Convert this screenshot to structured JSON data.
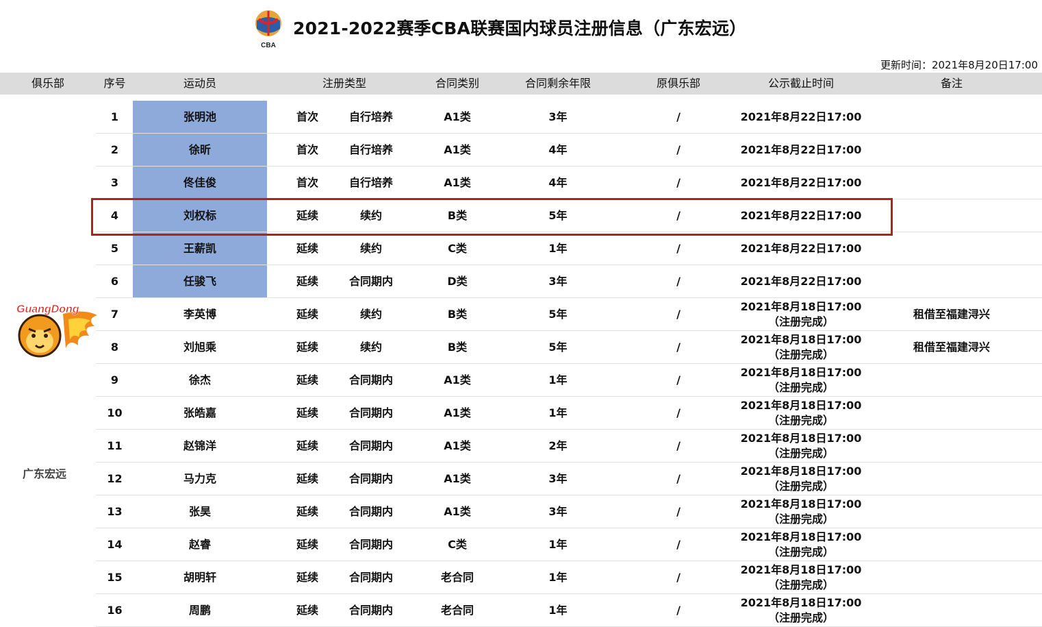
{
  "header": {
    "logo_text": "CBA",
    "title": "2021-2022赛季CBA联赛国内球员注册信息（广东宏远）",
    "update_time": "更新时间：2021年8月20日17:00"
  },
  "columns": [
    "俱乐部",
    "序号",
    "运动员",
    "注册类型",
    "合同类别",
    "合同剩余年限",
    "原俱乐部",
    "公示截止时间",
    "备注"
  ],
  "club": {
    "name": "广东宏远",
    "logo_text": "GuangDong"
  },
  "highlight_color": "#b0231d",
  "name_highlight_color": "#8eaadb",
  "rows": [
    {
      "no": "1",
      "name": "张明池",
      "reg1": "首次",
      "reg2": "自行培养",
      "contract": "A1类",
      "years": "3年",
      "orig": "/",
      "deadline": "2021年8月22日17:00",
      "status": "",
      "note": ""
    },
    {
      "no": "2",
      "name": "徐昕",
      "reg1": "首次",
      "reg2": "自行培养",
      "contract": "A1类",
      "years": "4年",
      "orig": "/",
      "deadline": "2021年8月22日17:00",
      "status": "",
      "note": ""
    },
    {
      "no": "3",
      "name": "佟佳俊",
      "reg1": "首次",
      "reg2": "自行培养",
      "contract": "A1类",
      "years": "4年",
      "orig": "/",
      "deadline": "2021年8月22日17:00",
      "status": "",
      "note": ""
    },
    {
      "no": "4",
      "name": "刘权标",
      "reg1": "延续",
      "reg2": "续约",
      "contract": "B类",
      "years": "5年",
      "orig": "/",
      "deadline": "2021年8月22日17:00",
      "status": "",
      "note": ""
    },
    {
      "no": "5",
      "name": "王薪凯",
      "reg1": "延续",
      "reg2": "续约",
      "contract": "C类",
      "years": "1年",
      "orig": "/",
      "deadline": "2021年8月22日17:00",
      "status": "",
      "note": ""
    },
    {
      "no": "6",
      "name": "任骏飞",
      "reg1": "延续",
      "reg2": "合同期内",
      "contract": "D类",
      "years": "3年",
      "orig": "/",
      "deadline": "2021年8月22日17:00",
      "status": "",
      "note": ""
    },
    {
      "no": "7",
      "name": "李英博",
      "reg1": "延续",
      "reg2": "续约",
      "contract": "B类",
      "years": "5年",
      "orig": "/",
      "deadline": "2021年8月18日17:00",
      "status": "（注册完成）",
      "note": "租借至福建浔兴"
    },
    {
      "no": "8",
      "name": "刘旭乘",
      "reg1": "延续",
      "reg2": "续约",
      "contract": "B类",
      "years": "5年",
      "orig": "/",
      "deadline": "2021年8月18日17:00",
      "status": "（注册完成）",
      "note": "租借至福建浔兴"
    },
    {
      "no": "9",
      "name": "徐杰",
      "reg1": "延续",
      "reg2": "合同期内",
      "contract": "A1类",
      "years": "1年",
      "orig": "/",
      "deadline": "2021年8月18日17:00",
      "status": "（注册完成）",
      "note": ""
    },
    {
      "no": "10",
      "name": "张皓嘉",
      "reg1": "延续",
      "reg2": "合同期内",
      "contract": "A1类",
      "years": "1年",
      "orig": "/",
      "deadline": "2021年8月18日17:00",
      "status": "（注册完成）",
      "note": ""
    },
    {
      "no": "11",
      "name": "赵锦洋",
      "reg1": "延续",
      "reg2": "合同期内",
      "contract": "A1类",
      "years": "2年",
      "orig": "/",
      "deadline": "2021年8月18日17:00",
      "status": "（注册完成）",
      "note": ""
    },
    {
      "no": "12",
      "name": "马力克",
      "reg1": "延续",
      "reg2": "合同期内",
      "contract": "A1类",
      "years": "3年",
      "orig": "/",
      "deadline": "2021年8月18日17:00",
      "status": "（注册完成）",
      "note": ""
    },
    {
      "no": "13",
      "name": "张昊",
      "reg1": "延续",
      "reg2": "合同期内",
      "contract": "A1类",
      "years": "3年",
      "orig": "/",
      "deadline": "2021年8月18日17:00",
      "status": "（注册完成）",
      "note": ""
    },
    {
      "no": "14",
      "name": "赵睿",
      "reg1": "延续",
      "reg2": "合同期内",
      "contract": "C类",
      "years": "1年",
      "orig": "/",
      "deadline": "2021年8月18日17:00",
      "status": "（注册完成）",
      "note": ""
    },
    {
      "no": "15",
      "name": "胡明轩",
      "reg1": "延续",
      "reg2": "合同期内",
      "contract": "老合同",
      "years": "1年",
      "orig": "/",
      "deadline": "2021年8月18日17:00",
      "status": "（注册完成）",
      "note": ""
    },
    {
      "no": "16",
      "name": "周鹏",
      "reg1": "延续",
      "reg2": "合同期内",
      "contract": "老合同",
      "years": "1年",
      "orig": "/",
      "deadline": "2021年8月18日17:00",
      "status": "（注册完成）",
      "note": ""
    }
  ]
}
